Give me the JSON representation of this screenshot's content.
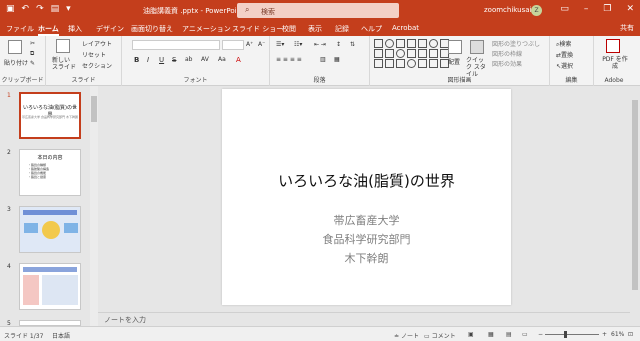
{
  "titlebar": {
    "qa_icons": [
      "save-icon",
      "undo-icon",
      "redo-icon",
      "present-icon",
      "more-icon"
    ],
    "doc_title": "油脂講義資 .pptx - PowerPoint",
    "search_placeholder": "検索",
    "user": "zoomchikusai",
    "avatar": "Z"
  },
  "tabs": [
    {
      "label": "ファイル"
    },
    {
      "label": "ホーム",
      "active": true
    },
    {
      "label": "挿入"
    },
    {
      "label": "デザイン"
    },
    {
      "label": "画面切り替え"
    },
    {
      "label": "アニメーション"
    },
    {
      "label": "スライド ショー"
    },
    {
      "label": "校閲"
    },
    {
      "label": "表示"
    },
    {
      "label": "記録"
    },
    {
      "label": "ヘルプ"
    },
    {
      "label": "Acrobat"
    }
  ],
  "share": "共有",
  "ribbon": {
    "clipboard": {
      "label": "クリップボード",
      "paste": "貼り付け"
    },
    "slides": {
      "label": "スライド",
      "new_slide": "新しい スライド",
      "layout": "レイアウト",
      "reset": "リセット",
      "section": "セクション"
    },
    "font": {
      "label": "フォント",
      "buttons": [
        "B",
        "I",
        "U",
        "S",
        "ab",
        "AV",
        "Aa",
        "A"
      ]
    },
    "paragraph": {
      "label": "段落"
    },
    "drawing": {
      "label": "図形描画",
      "arrange": "配置",
      "quick_style": "クイック スタイル",
      "fill": "図形の塗りつぶし",
      "outline": "図形の枠線",
      "effect": "図形の効果"
    },
    "editing": {
      "label": "編集",
      "find": "検索",
      "replace": "置換",
      "select": "選択"
    },
    "adobe": {
      "label": "Adobe",
      "pdf": "PDF を作成"
    }
  },
  "slides_pane": {
    "thumbs": [
      {
        "num": "1",
        "title": "いろいろな油(脂質)の世界",
        "sub": "帯広畜産大学 食品科学研究部門 木下幹朗"
      },
      {
        "num": "2",
        "title": "本日の内容",
        "bullets": "・脂質の種類\n・脂肪酸の構造\n・脂質の機能\n・脂質と健康"
      },
      {
        "num": "3"
      },
      {
        "num": "4"
      },
      {
        "num": "5"
      }
    ]
  },
  "slide": {
    "title": "いろいろな油(脂質)の世界",
    "line1": "帯広畜産大学",
    "line2": "食品科学研究部門",
    "line3": "木下幹朗"
  },
  "notes_placeholder": "ノートを入力",
  "status": {
    "slide_count": "スライド 1/37",
    "language": "日本語",
    "notes": "ノート",
    "comments": "コメント",
    "zoom": "61%"
  },
  "colors": {
    "accent": "#c43e1c"
  }
}
